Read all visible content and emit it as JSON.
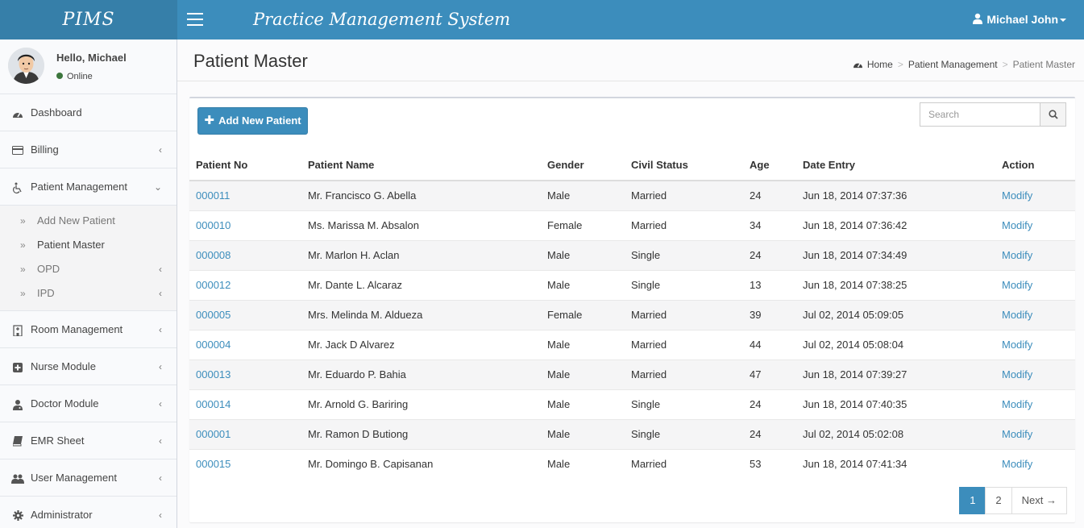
{
  "header": {
    "logo": "PIMS",
    "app_title": "Practice Management System",
    "user_name": "Michael John"
  },
  "sidebar": {
    "greeting": "Hello, Michael",
    "status": "Online",
    "items": [
      {
        "label": "Dashboard",
        "icon": "dashboard-icon"
      },
      {
        "label": "Billing",
        "icon": "credit-card-icon"
      },
      {
        "label": "Patient Management",
        "icon": "wheelchair-icon"
      },
      {
        "label": "Room Management",
        "icon": "hospital-icon"
      },
      {
        "label": "Nurse Module",
        "icon": "plus-square-icon"
      },
      {
        "label": "Doctor Module",
        "icon": "user-md-icon"
      },
      {
        "label": "EMR Sheet",
        "icon": "book-icon"
      },
      {
        "label": "User Management",
        "icon": "users-icon"
      },
      {
        "label": "Administrator",
        "icon": "gear-icon"
      }
    ],
    "subitems": [
      {
        "label": "Add New Patient"
      },
      {
        "label": "Patient Master"
      },
      {
        "label": "OPD"
      },
      {
        "label": "IPD"
      }
    ]
  },
  "page": {
    "title": "Patient Master",
    "breadcrumb": [
      "Home",
      "Patient Management",
      "Patient Master"
    ]
  },
  "toolbar": {
    "add_label": "Add New Patient",
    "search_placeholder": "Search"
  },
  "table": {
    "columns": [
      "Patient No",
      "Patient Name",
      "Gender",
      "Civil Status",
      "Age",
      "Date Entry",
      "Action"
    ],
    "rows": [
      {
        "no": "000011",
        "name": "Mr. Francisco G. Abella",
        "gender": "Male",
        "civil": "Married",
        "age": "24",
        "date": "Jun 18, 2014 07:37:36",
        "action": "Modify"
      },
      {
        "no": "000010",
        "name": "Ms. Marissa M. Absalon",
        "gender": "Female",
        "civil": "Married",
        "age": "34",
        "date": "Jun 18, 2014 07:36:42",
        "action": "Modify"
      },
      {
        "no": "000008",
        "name": "Mr. Marlon H. Aclan",
        "gender": "Male",
        "civil": "Single",
        "age": "24",
        "date": "Jun 18, 2014 07:34:49",
        "action": "Modify"
      },
      {
        "no": "000012",
        "name": "Mr. Dante L. Alcaraz",
        "gender": "Male",
        "civil": "Single",
        "age": "13",
        "date": "Jun 18, 2014 07:38:25",
        "action": "Modify"
      },
      {
        "no": "000005",
        "name": "Mrs. Melinda M. Aldueza",
        "gender": "Female",
        "civil": "Married",
        "age": "39",
        "date": "Jul 02, 2014 05:09:05",
        "action": "Modify"
      },
      {
        "no": "000004",
        "name": "Mr. Jack D Alvarez",
        "gender": "Male",
        "civil": "Married",
        "age": "44",
        "date": "Jul 02, 2014 05:08:04",
        "action": "Modify"
      },
      {
        "no": "000013",
        "name": "Mr. Eduardo P. Bahia",
        "gender": "Male",
        "civil": "Married",
        "age": "47",
        "date": "Jun 18, 2014 07:39:27",
        "action": "Modify"
      },
      {
        "no": "000014",
        "name": "Mr. Arnold G. Bariring",
        "gender": "Male",
        "civil": "Single",
        "age": "24",
        "date": "Jun 18, 2014 07:40:35",
        "action": "Modify"
      },
      {
        "no": "000001",
        "name": "Mr. Ramon D Butiong",
        "gender": "Male",
        "civil": "Single",
        "age": "24",
        "date": "Jul 02, 2014 05:02:08",
        "action": "Modify"
      },
      {
        "no": "000015",
        "name": "Mr. Domingo B. Capisanan",
        "gender": "Male",
        "civil": "Married",
        "age": "53",
        "date": "Jun 18, 2014 07:41:34",
        "action": "Modify"
      }
    ]
  },
  "pagination": {
    "pages": [
      "1",
      "2"
    ],
    "current": "1",
    "next_label": "Next →"
  },
  "colors": {
    "primary": "#3c8dbc",
    "logo_bg": "#367fa9",
    "online": "#3c763d"
  }
}
